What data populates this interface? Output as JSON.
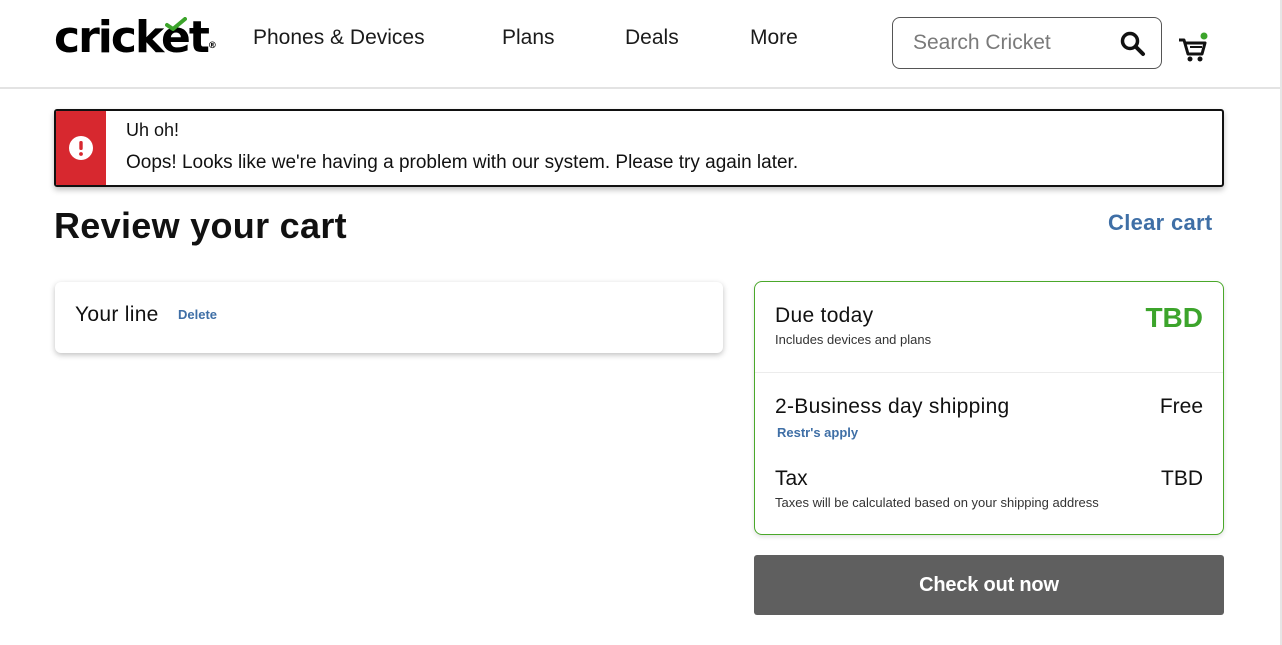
{
  "header": {
    "logo_text": "cricket",
    "logo_mark": "®",
    "nav": [
      "Phones & Devices",
      "Plans",
      "Deals",
      "More"
    ],
    "search_placeholder": "Search Cricket",
    "search_icon": "search-icon",
    "cart_icon": "cart-icon",
    "cart_badge_color": "#3ca42b"
  },
  "alert": {
    "title": "Uh oh!",
    "message": "Oops! Looks like we're having a problem with our system. Please try again later.",
    "icon": "exclamation-circle-icon",
    "color": "#d7282f"
  },
  "page": {
    "title": "Review your cart",
    "clear_cart": "Clear cart"
  },
  "line": {
    "label": "Your line",
    "delete": "Delete"
  },
  "summary": {
    "due_label": "Due today",
    "due_sub": "Includes devices and plans",
    "due_value": "TBD",
    "shipping_label": "2-Business day shipping",
    "shipping_value": "Free",
    "restrictions": "Restr's apply",
    "tax_label": "Tax",
    "tax_value": "TBD",
    "tax_sub": "Taxes will be calculated based on your shipping address",
    "accent": "#3ca42b"
  },
  "checkout": {
    "label": "Check out now"
  }
}
